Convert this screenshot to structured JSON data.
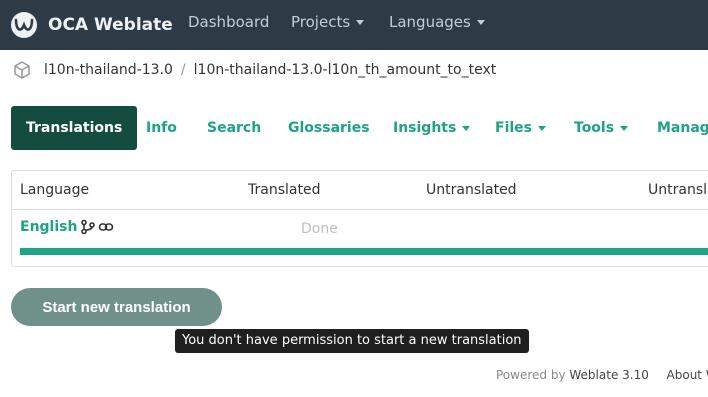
{
  "navbar": {
    "brand": "OCA Weblate",
    "items": [
      {
        "label": "Dashboard",
        "has_caret": false
      },
      {
        "label": "Projects",
        "has_caret": true
      },
      {
        "label": "Languages",
        "has_caret": true
      }
    ]
  },
  "breadcrumb": {
    "icon": "cube-icon",
    "project": "l10n-thailand-13.0",
    "separator": "/",
    "component": "l10n-thailand-13.0-l10n_th_amount_to_text"
  },
  "tabs": [
    {
      "label": "Translations",
      "active": true,
      "has_caret": false
    },
    {
      "label": "Info",
      "active": false,
      "has_caret": false
    },
    {
      "label": "Search",
      "active": false,
      "has_caret": false
    },
    {
      "label": "Glossaries",
      "active": false,
      "has_caret": false
    },
    {
      "label": "Insights",
      "active": false,
      "has_caret": true
    },
    {
      "label": "Files",
      "active": false,
      "has_caret": true
    },
    {
      "label": "Tools",
      "active": false,
      "has_caret": true
    },
    {
      "label": "Manage",
      "active": false,
      "has_caret": false
    }
  ],
  "table": {
    "headers": [
      "Language",
      "Translated",
      "Untranslated",
      "Untransla"
    ],
    "rows": [
      {
        "language": "English",
        "icons": [
          "git-icon",
          "link-icon"
        ],
        "status": "Done",
        "progress_percent": 100
      }
    ]
  },
  "actions": {
    "start_translation": "Start new translation",
    "tooltip": "You don't have permission to start a new translation"
  },
  "footer": {
    "powered_by": "Powered by",
    "weblate_version": "Weblate 3.10",
    "about": "About We"
  },
  "colors": {
    "navbar_bg": "#2e3b47",
    "accent": "#1fa385",
    "active_tab": "#144d3f",
    "button_bg": "#6f918a"
  }
}
